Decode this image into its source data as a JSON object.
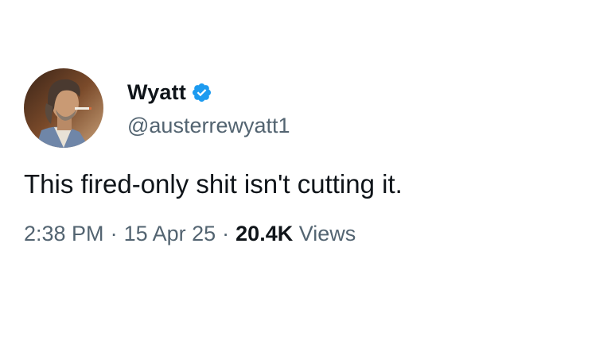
{
  "author": {
    "display_name": "Wyatt",
    "handle": "@austerrewyatt1",
    "verified_icon": "verified-badge-icon",
    "avatar_icon": "profile-photo"
  },
  "tweet": {
    "text": "This fired-only shit isn't cutting it."
  },
  "meta": {
    "time": "2:38 PM",
    "separator": "·",
    "date": "15 Apr 25",
    "views_count": "20.4K",
    "views_label": "Views"
  },
  "colors": {
    "text_primary": "#0f1419",
    "text_secondary": "#536471",
    "verified_blue": "#1d9bf0",
    "background": "#ffffff"
  }
}
